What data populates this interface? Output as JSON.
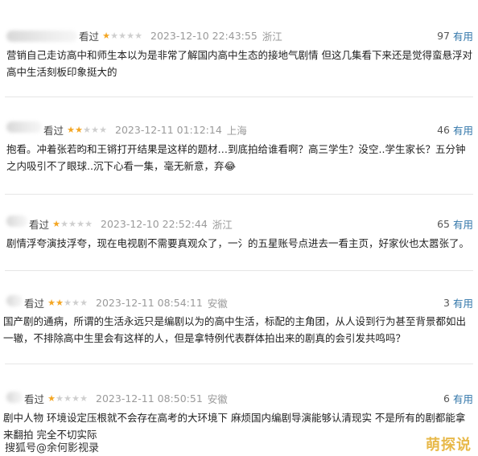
{
  "reviews": [
    {
      "username": "看过",
      "rating": 1,
      "date": "2023-12-10 22:43:55",
      "location": "浙江",
      "useful_count": "97",
      "useful_label": "有用",
      "content": "营销自己走访高中和师生本以为是非常了解国内高中生态的接地气剧情 但这几集看下来还是觉得蛮悬浮对高中生活刻板印象挺大的"
    },
    {
      "username": "看过",
      "rating": 2,
      "date": "2023-12-11 01:12:14",
      "location": "上海",
      "useful_count": "46",
      "useful_label": "有用",
      "content": "抱看。冲着张若昀和王锵打开结果是这样的题材…到底拍给谁看啊？高三学生？没空..学生家长？五分钟之内吸引不了眼球..沉下心看一集，毫无新意，弃😂"
    },
    {
      "username": "看过",
      "rating": 1,
      "date": "2023-12-10 22:52:44",
      "location": "浙江",
      "useful_count": "65",
      "useful_label": "有用",
      "content": "剧情浮夸演技浮夸，现在电视剧不需要真观众了，一氵的五星账号点进去一看主页，好家伙也太嚣张了。"
    },
    {
      "username": "看过",
      "rating": 2,
      "date": "2023-12-11 08:54:11",
      "location": "安徽",
      "useful_count": "3",
      "useful_label": "有用",
      "content": "国产剧的通病，所谓的生活永远只是编剧以为的高中生活，标配的主角团，从人设到行为甚至背景都如出一辙，不排除高中生里会有这样的人，但是拿特例代表群体拍出来的剧真的会引发共鸣吗？"
    },
    {
      "username": "看过",
      "rating": 1,
      "date": "2023-12-11 08:50:51",
      "location": "安徽",
      "useful_count": "6",
      "useful_label": "有用",
      "content": "剧中人物 环境设定压根就不会存在高考的大环境下 麻烦国内编剧导演能够认清现实 不是所有的剧都能拿来翻拍 完全不切实际"
    }
  ],
  "watermark_left": "搜狐号@余何影视录",
  "watermark_right": "萌探说",
  "colors": {
    "star_on": "#f4a623",
    "star_off": "#cfcfcf",
    "useful_link": "#3377aa",
    "meta_gray": "#9a9a9a"
  }
}
